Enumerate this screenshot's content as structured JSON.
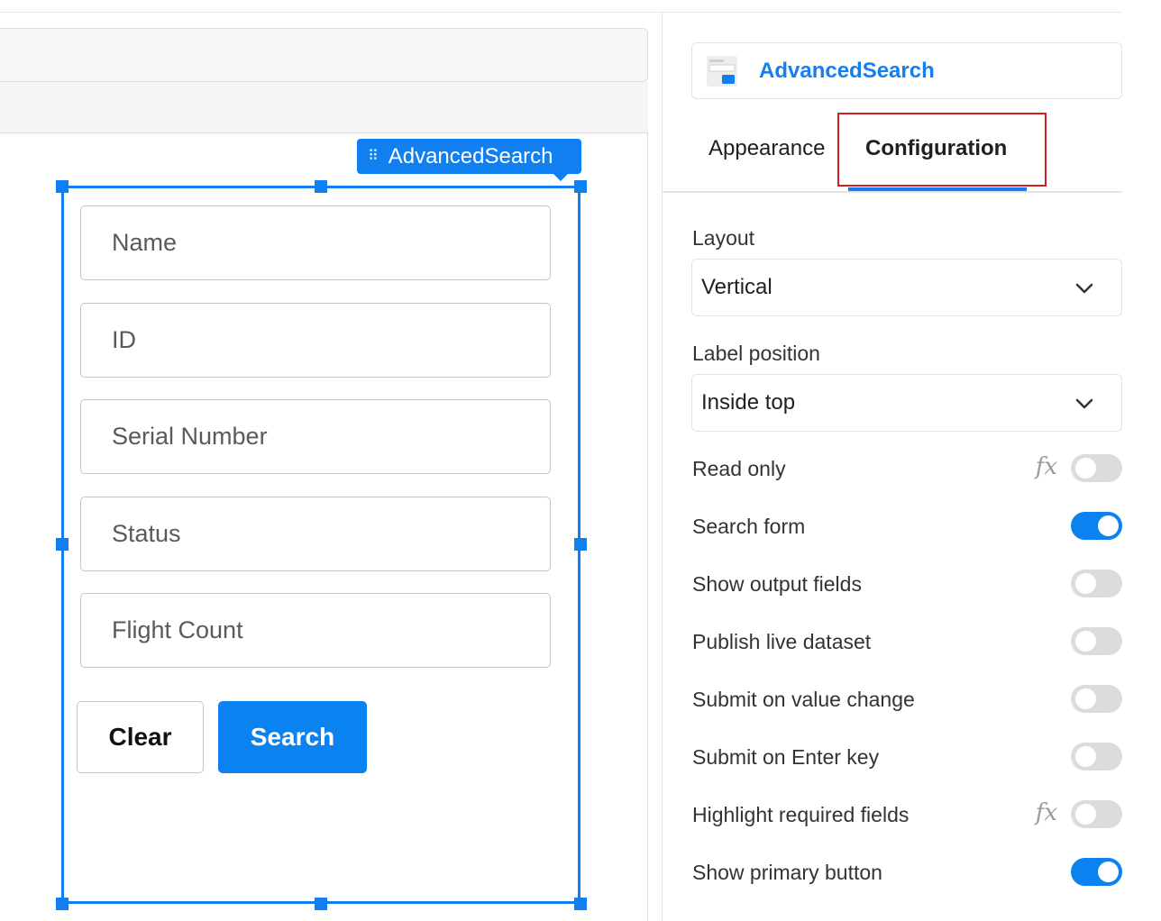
{
  "canvas": {
    "widget_tag": "AdvancedSearch",
    "fields": [
      {
        "placeholder": "Name"
      },
      {
        "placeholder": "ID"
      },
      {
        "placeholder": "Serial Number"
      },
      {
        "placeholder": "Status"
      },
      {
        "placeholder": "Flight Count"
      }
    ],
    "buttons": {
      "clear_label": "Clear",
      "search_label": "Search"
    }
  },
  "panel": {
    "component_name": "AdvancedSearch",
    "tabs": [
      {
        "label": "Appearance",
        "active": false
      },
      {
        "label": "Configuration",
        "active": true
      }
    ],
    "layout": {
      "label": "Layout",
      "value": "Vertical"
    },
    "label_position": {
      "label": "Label position",
      "value": "Inside top"
    },
    "options": [
      {
        "label": "Read only",
        "on": false,
        "fx": true
      },
      {
        "label": "Search form",
        "on": true,
        "fx": false
      },
      {
        "label": "Show output fields",
        "on": false,
        "fx": false
      },
      {
        "label": "Publish live dataset",
        "on": false,
        "fx": false
      },
      {
        "label": "Submit on value change",
        "on": false,
        "fx": false
      },
      {
        "label": "Submit on Enter key",
        "on": false,
        "fx": false
      },
      {
        "label": "Highlight required fields",
        "on": false,
        "fx": true
      },
      {
        "label": "Show primary button",
        "on": true,
        "fx": false
      }
    ]
  },
  "colors": {
    "accent": "#1080f0",
    "highlight_border": "#d21f1f",
    "toggle_off": "#dcdcdc"
  },
  "icons": {
    "grip": "drag-handle-icon",
    "component": "advanced-search-component-icon",
    "chevron": "chevron-down-icon",
    "fx": "fx-formula-icon"
  }
}
